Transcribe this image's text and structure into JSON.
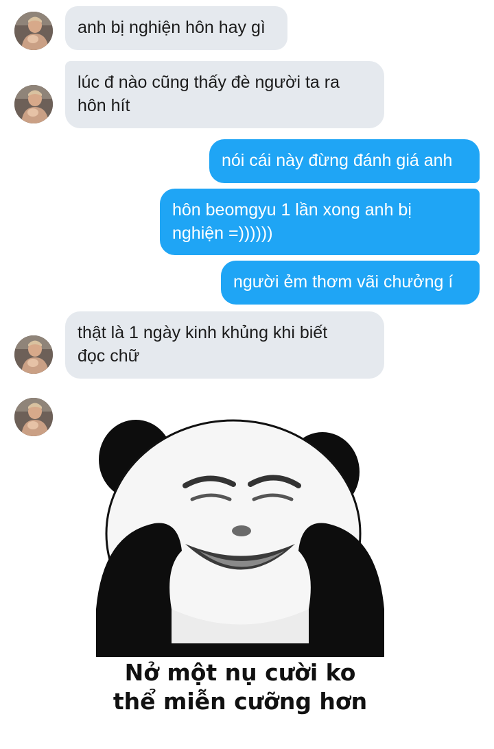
{
  "conversation": {
    "messages": [
      {
        "sender": "other",
        "text": "anh bị nghiện hôn hay gì"
      },
      {
        "sender": "other",
        "text": "lúc đ nào cũng thấy đè người ta ra\nhôn hít"
      },
      {
        "sender": "me",
        "text": "nói cái này đừng đánh giá anh"
      },
      {
        "sender": "me",
        "text": "hôn beomgyu 1 lần xong anh bị\nnghiện =))))))"
      },
      {
        "sender": "me",
        "text": "người ẻm thơm vãi chưởng í"
      },
      {
        "sender": "other",
        "text": "thật là 1 ngày kinh khủng khi biết\nđọc chữ"
      }
    ],
    "sticker": {
      "icon": "panda-meme-sticker",
      "caption": "Nở một nụ cười ko\nthể miễn cưỡng hơn"
    }
  },
  "colors": {
    "incoming_bubble": "#e5e9ee",
    "outgoing_bubble": "#1fa5f5",
    "outgoing_text": "#ffffff",
    "incoming_text": "#1c1c1c"
  }
}
